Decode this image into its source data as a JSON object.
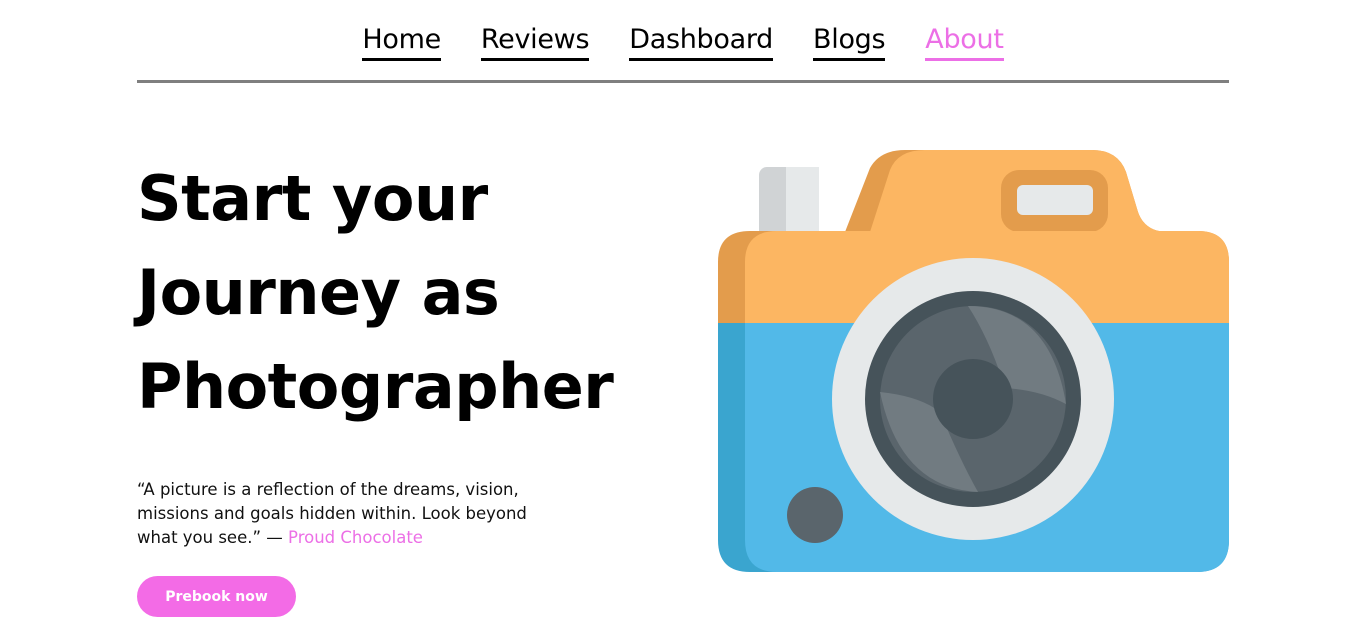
{
  "nav": {
    "items": [
      {
        "label": "Home",
        "active": false
      },
      {
        "label": "Reviews",
        "active": false
      },
      {
        "label": "Dashboard",
        "active": false
      },
      {
        "label": "Blogs",
        "active": false
      },
      {
        "label": "About",
        "active": true
      }
    ]
  },
  "hero": {
    "title_lines": [
      "Start your",
      "Journey as",
      "Photographer"
    ],
    "quote_text": "“A picture is a reflection of the dreams, vision, missions and goals hidden within. Look beyond what you see.” —",
    "quote_author": "Proud Chocolate",
    "cta_label": "Prebook now"
  },
  "colors": {
    "accent": "#ec6fe6",
    "button": "#f36be6",
    "camera_top": "#fcb662",
    "camera_bottom": "#52b9e8",
    "lens_ring": "#e6e9ea",
    "lens_dark": "#46535a"
  },
  "illustration": {
    "icon": "camera-icon"
  }
}
